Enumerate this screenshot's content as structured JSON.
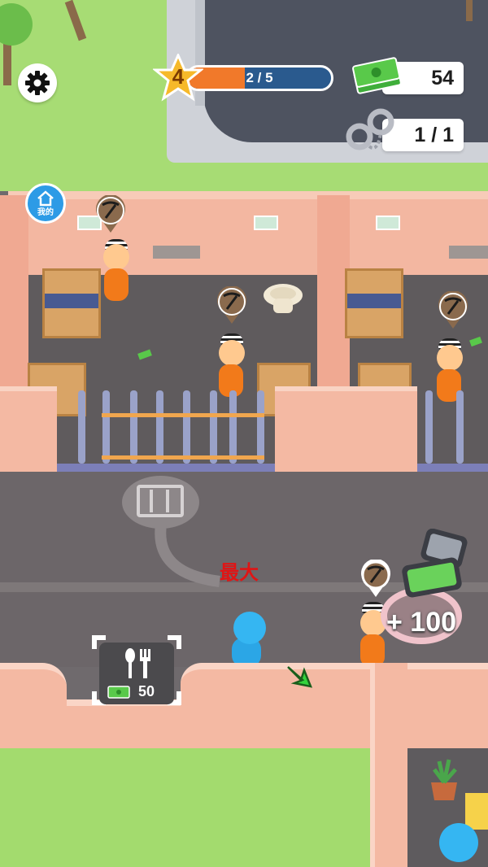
{
  "hud": {
    "level": "4",
    "level_progress_text": "2 / 5",
    "level_progress_fraction": 0.4,
    "cash": "54",
    "handcuffs": "1 / 1",
    "mine_badge_label": "我的"
  },
  "world": {
    "max_label": "最大",
    "food_station_cost": "50",
    "cash_pickup_label": "+ 100"
  },
  "icons": {
    "settings": "gear-icon",
    "level": "star-icon",
    "cash": "cash-stack-icon",
    "handcuffs": "handcuffs-icon",
    "task": "pickaxe-icon",
    "food": "fork-spoon-icon",
    "door": "cell-door-icon",
    "direction": "arrow-down-right-icon"
  },
  "colors": {
    "progress_fill": "#f1792a",
    "progress_track": "#2a5a8e",
    "max_label": "#e01515",
    "prisoner_uniform": "#f27a1a",
    "player": "#35b6f2"
  }
}
